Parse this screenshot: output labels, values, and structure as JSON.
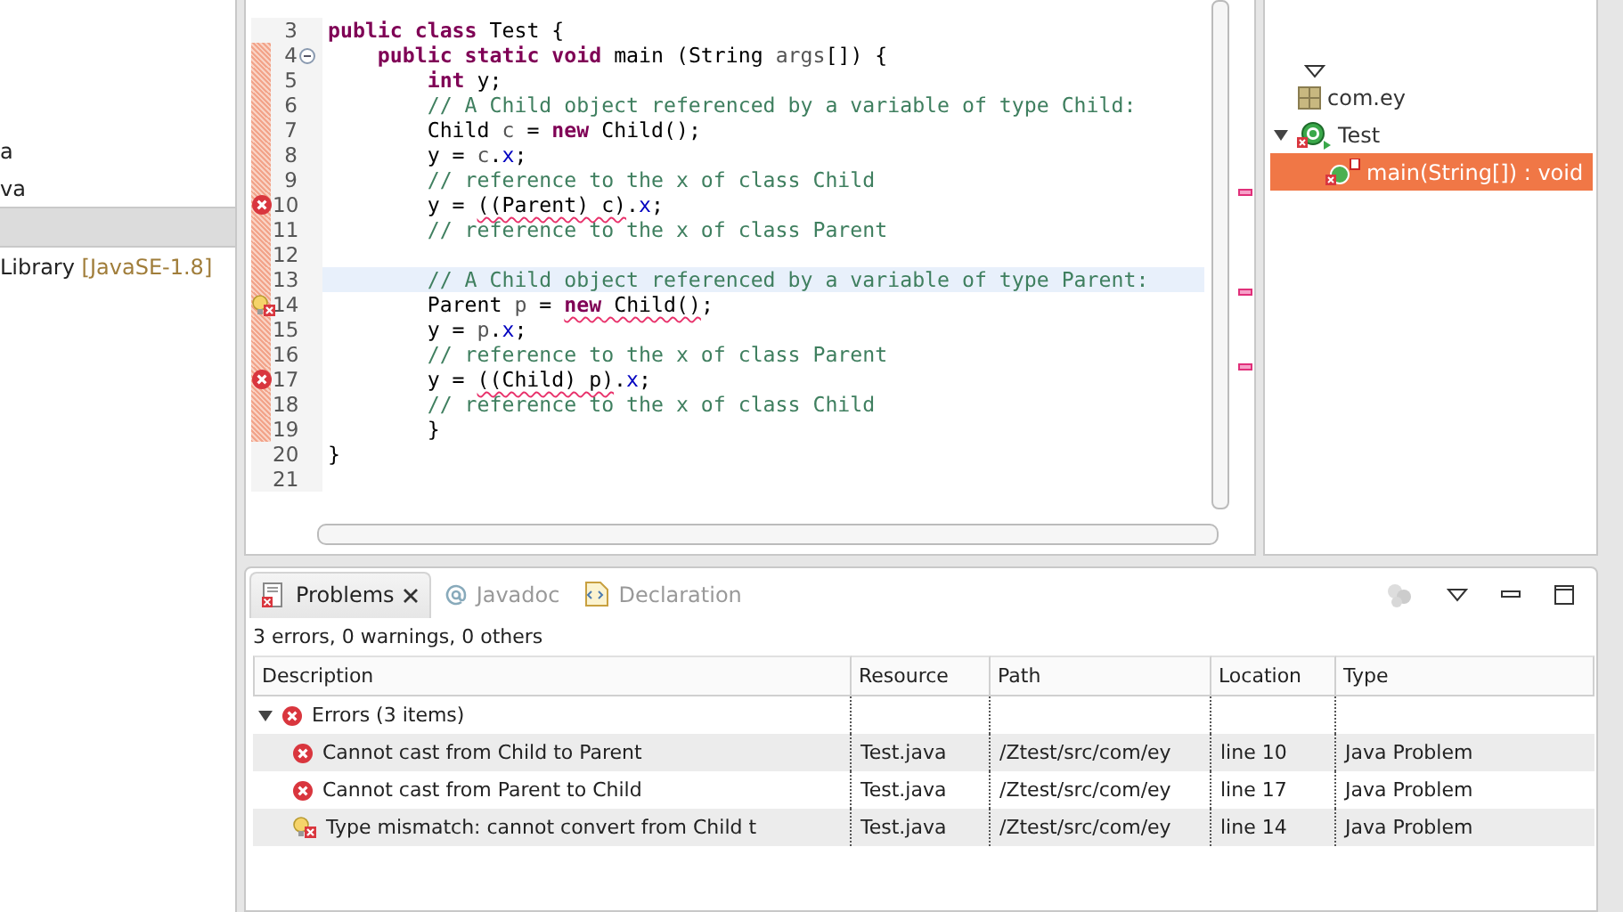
{
  "explorer": {
    "items": [
      {
        "label": "a",
        "selected": false
      },
      {
        "label": "va",
        "selected": false
      },
      {
        "selected": true
      },
      {
        "label": "Library",
        "decoration": "[JavaSE-1.8]",
        "selected": false
      }
    ]
  },
  "editor": {
    "lines": [
      {
        "number": "3",
        "error": false,
        "quick_fix": false,
        "fold": false,
        "range": false,
        "current": false,
        "segments": [
          {
            "text": "public",
            "kind": "keyword",
            "squiggle": false
          },
          {
            "text": " class",
            "kind": "keyword",
            "squiggle": false
          },
          {
            "text": " Test {",
            "kind": "plain",
            "squiggle": false
          }
        ]
      },
      {
        "number": "4",
        "error": false,
        "quick_fix": false,
        "fold": true,
        "range": true,
        "current": false,
        "segments": [
          {
            "text": "\tpublic",
            "kind": "keyword",
            "squiggle": false
          },
          {
            "text": " static",
            "kind": "keyword",
            "squiggle": false
          },
          {
            "text": " void",
            "kind": "keyword",
            "squiggle": false
          },
          {
            "text": " main (String ",
            "kind": "plain",
            "squiggle": false
          },
          {
            "text": "args",
            "kind": "local",
            "squiggle": false
          },
          {
            "text": "[]) {",
            "kind": "plain",
            "squiggle": false
          }
        ]
      },
      {
        "number": "5",
        "error": false,
        "quick_fix": false,
        "fold": false,
        "range": true,
        "current": false,
        "segments": [
          {
            "text": "\t\tint",
            "kind": "keyword",
            "squiggle": false
          },
          {
            "text": " y;",
            "kind": "plain",
            "squiggle": false
          }
        ]
      },
      {
        "number": "6",
        "error": false,
        "quick_fix": false,
        "fold": false,
        "range": true,
        "current": false,
        "segments": [
          {
            "text": "\t\t// A Child object referenced by a variable of type Child:",
            "kind": "comment",
            "squiggle": false
          }
        ]
      },
      {
        "number": "7",
        "error": false,
        "quick_fix": false,
        "fold": false,
        "range": true,
        "current": false,
        "segments": [
          {
            "text": "\t\tChild ",
            "kind": "plain",
            "squiggle": false
          },
          {
            "text": "c",
            "kind": "local",
            "squiggle": false
          },
          {
            "text": " = ",
            "kind": "plain",
            "squiggle": false
          },
          {
            "text": "new",
            "kind": "keyword",
            "squiggle": false
          },
          {
            "text": " Child();",
            "kind": "plain",
            "squiggle": false
          }
        ]
      },
      {
        "number": "8",
        "error": false,
        "quick_fix": false,
        "fold": false,
        "range": true,
        "current": false,
        "segments": [
          {
            "text": "\t\ty = ",
            "kind": "plain",
            "squiggle": false
          },
          {
            "text": "c",
            "kind": "local",
            "squiggle": false
          },
          {
            "text": ".",
            "kind": "plain",
            "squiggle": false
          },
          {
            "text": "x",
            "kind": "field",
            "squiggle": false
          },
          {
            "text": ";",
            "kind": "plain",
            "squiggle": false
          }
        ]
      },
      {
        "number": "9",
        "error": false,
        "quick_fix": false,
        "fold": false,
        "range": true,
        "current": false,
        "segments": [
          {
            "text": "\t\t// reference to the x of class Child",
            "kind": "comment",
            "squiggle": false
          }
        ]
      },
      {
        "number": "10",
        "error": true,
        "quick_fix": false,
        "fold": false,
        "range": true,
        "current": false,
        "segments": [
          {
            "text": "\t\ty = ",
            "kind": "plain",
            "squiggle": false
          },
          {
            "text": "((Parent) c)",
            "kind": "plain",
            "squiggle": true
          },
          {
            "text": ".",
            "kind": "plain",
            "squiggle": false
          },
          {
            "text": "x",
            "kind": "field",
            "squiggle": false
          },
          {
            "text": ";",
            "kind": "plain",
            "squiggle": false
          }
        ]
      },
      {
        "number": "11",
        "error": false,
        "quick_fix": false,
        "fold": false,
        "range": true,
        "current": false,
        "segments": [
          {
            "text": "\t\t// reference to the x of class Parent",
            "kind": "comment",
            "squiggle": false
          }
        ]
      },
      {
        "number": "12",
        "error": false,
        "quick_fix": false,
        "fold": false,
        "range": true,
        "current": false
      },
      {
        "number": "13",
        "error": false,
        "quick_fix": false,
        "fold": false,
        "range": true,
        "current": true,
        "segments": [
          {
            "text": "\t\t// A Child object referenced by a variable of type Parent:",
            "kind": "comment",
            "squiggle": false
          }
        ]
      },
      {
        "number": "14",
        "error": true,
        "quick_fix": true,
        "fold": false,
        "range": true,
        "current": false,
        "segments": [
          {
            "text": "\t\tParent ",
            "kind": "plain",
            "squiggle": false
          },
          {
            "text": "p",
            "kind": "local",
            "squiggle": false
          },
          {
            "text": " = ",
            "kind": "plain",
            "squiggle": false
          },
          {
            "text": "new",
            "kind": "keyword",
            "squiggle": true
          },
          {
            "text": " Child()",
            "kind": "plain",
            "squiggle": true
          },
          {
            "text": ";",
            "kind": "plain",
            "squiggle": false
          }
        ]
      },
      {
        "number": "15",
        "error": false,
        "quick_fix": false,
        "fold": false,
        "range": true,
        "current": false,
        "segments": [
          {
            "text": "\t\ty = ",
            "kind": "plain",
            "squiggle": false
          },
          {
            "text": "p",
            "kind": "local",
            "squiggle": false
          },
          {
            "text": ".",
            "kind": "plain",
            "squiggle": false
          },
          {
            "text": "x",
            "kind": "field",
            "squiggle": false
          },
          {
            "text": ";",
            "kind": "plain",
            "squiggle": false
          }
        ]
      },
      {
        "number": "16",
        "error": false,
        "quick_fix": false,
        "fold": false,
        "range": true,
        "current": false,
        "segments": [
          {
            "text": "\t\t// reference to the x of class Parent",
            "kind": "comment",
            "squiggle": false
          }
        ]
      },
      {
        "number": "17",
        "error": true,
        "quick_fix": false,
        "fold": false,
        "range": true,
        "current": false,
        "segments": [
          {
            "text": "\t\ty = ",
            "kind": "plain",
            "squiggle": false
          },
          {
            "text": "((Child) p)",
            "kind": "plain",
            "squiggle": true
          },
          {
            "text": ".",
            "kind": "plain",
            "squiggle": false
          },
          {
            "text": "x",
            "kind": "field",
            "squiggle": false
          },
          {
            "text": ";",
            "kind": "plain",
            "squiggle": false
          }
        ]
      },
      {
        "number": "18",
        "error": false,
        "quick_fix": false,
        "fold": false,
        "range": true,
        "current": false,
        "segments": [
          {
            "text": "\t\t// reference to the x of class Child",
            "kind": "comment",
            "squiggle": false
          }
        ]
      },
      {
        "number": "19",
        "error": false,
        "quick_fix": false,
        "fold": false,
        "range": true,
        "current": false,
        "segments": [
          {
            "text": "\t\t}",
            "kind": "plain",
            "squiggle": false
          }
        ]
      },
      {
        "number": "20",
        "error": false,
        "quick_fix": false,
        "fold": false,
        "range": false,
        "current": false,
        "segments": [
          {
            "text": "}",
            "kind": "plain",
            "squiggle": false
          }
        ]
      },
      {
        "number": "21",
        "error": false,
        "quick_fix": false,
        "fold": false,
        "range": false,
        "current": false
      }
    ]
  },
  "outline": {
    "items": [
      {
        "label": "com.ey",
        "kind": "package",
        "selected": false
      },
      {
        "label": "Test",
        "kind": "class",
        "selected": false,
        "expanded": true,
        "children": [
          {
            "label": "main(String[]) : void",
            "kind": "method",
            "selected": true
          }
        ]
      }
    ]
  },
  "problems": {
    "tabs": [
      {
        "label": "Problems",
        "kind": "problems",
        "selected": true
      },
      {
        "label": "Javadoc",
        "kind": "javadoc",
        "selected": false
      },
      {
        "label": "Declaration",
        "kind": "declaration",
        "selected": false
      }
    ],
    "summary": "3 errors, 0 warnings, 0 others",
    "columns": [
      "Description",
      "Resource",
      "Path",
      "Location",
      "Type"
    ],
    "groups": [
      {
        "label": "Errors (3 items)",
        "expanded": true,
        "rows": [
          {
            "kind": "error",
            "description": "Cannot cast from Child to Parent",
            "resource": "Test.java",
            "path": "/Ztest/src/com/ey",
            "location": "line 10",
            "type": "Java Problem"
          },
          {
            "kind": "error",
            "description": "Cannot cast from Parent to Child",
            "resource": "Test.java",
            "path": "/Ztest/src/com/ey",
            "location": "line 17",
            "type": "Java Problem"
          },
          {
            "kind": "quick-fix-error",
            "description": "Type mismatch: cannot convert from Child t",
            "resource": "Test.java",
            "path": "/Ztest/src/com/ey",
            "location": "line 14",
            "type": "Java Problem"
          }
        ]
      }
    ]
  }
}
